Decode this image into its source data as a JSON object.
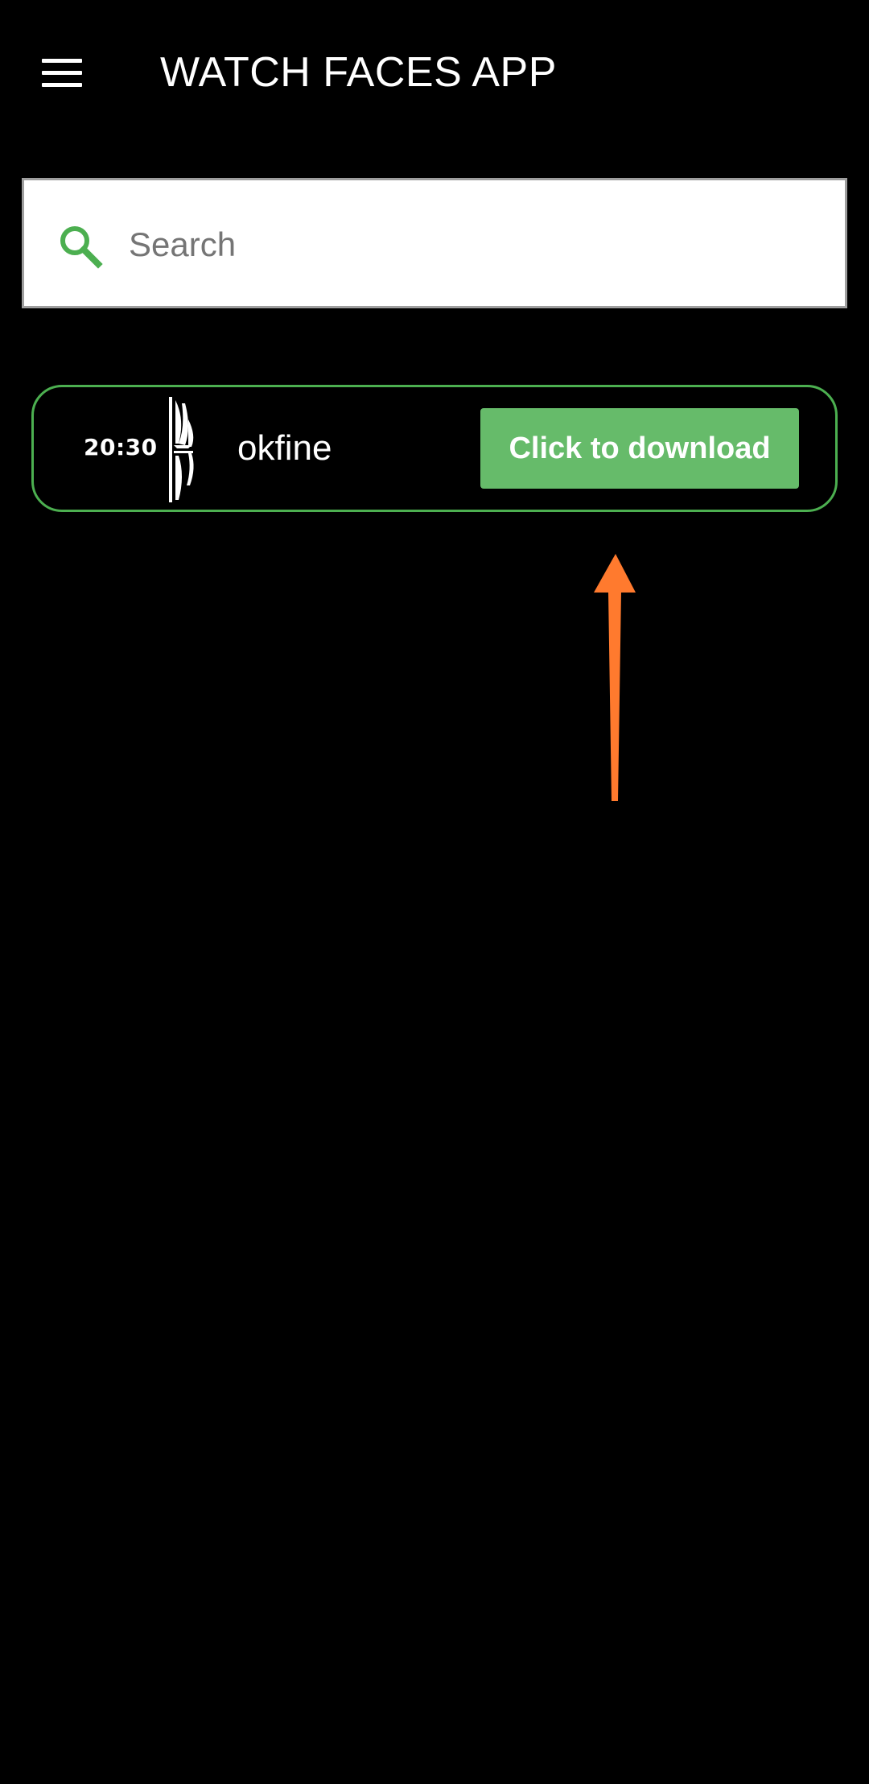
{
  "app_bar": {
    "title": "WATCH FACES APP",
    "menu_icon": "hamburger-menu-icon"
  },
  "search": {
    "placeholder": "Search",
    "value": "",
    "icon": "search-icon"
  },
  "items": [
    {
      "name": "okfine",
      "thumbnail_time": "20:30",
      "download_label": "Click to download"
    }
  ],
  "colors": {
    "background": "#000000",
    "accent": "#66bb6a",
    "card_border": "#4caf50",
    "annotation_arrow": "#ff7a2e"
  }
}
